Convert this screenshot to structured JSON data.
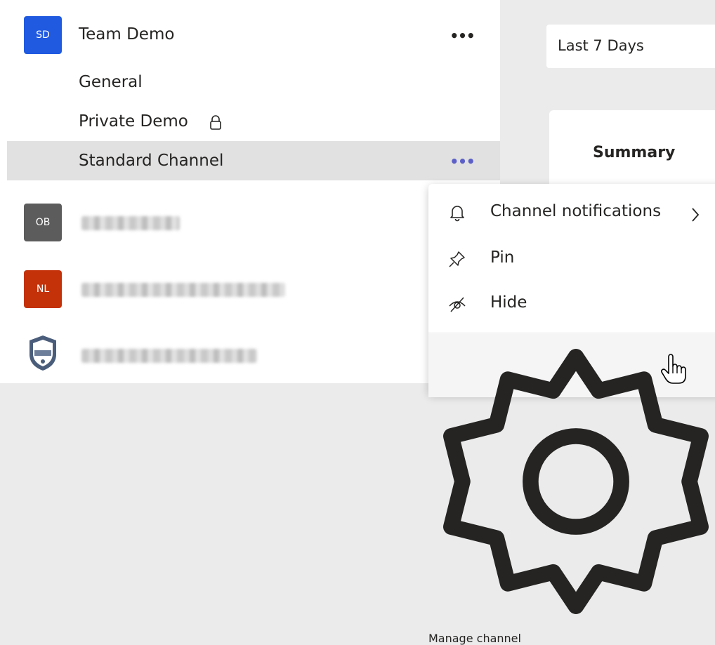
{
  "sidebar": {
    "team": {
      "avatar_initials": "SD",
      "avatar_color": "#1f5ae0",
      "name": "Team Demo",
      "more_label": "•••"
    },
    "channels": [
      {
        "label": "General"
      },
      {
        "label": "Private Demo"
      },
      {
        "label": "Standard Channel",
        "more_label": "•••"
      }
    ],
    "other_teams": [
      {
        "avatar_initials": "OB",
        "avatar_color": "#5c5c5c"
      },
      {
        "avatar_initials": "NL",
        "avatar_color": "#c4320a"
      },
      {
        "avatar_initials": "",
        "avatar_color": "#4a5d7a"
      }
    ]
  },
  "main": {
    "date_range": "Last 7 Days",
    "summary_label": "Summary"
  },
  "context_menu": {
    "items": [
      {
        "label": "Channel notifications",
        "icon": "bell-icon"
      },
      {
        "label": "Pin",
        "icon": "pin-icon"
      },
      {
        "label": "Hide",
        "icon": "hide-icon"
      },
      {
        "label": "Manage channel",
        "icon": "gear-icon"
      }
    ]
  }
}
